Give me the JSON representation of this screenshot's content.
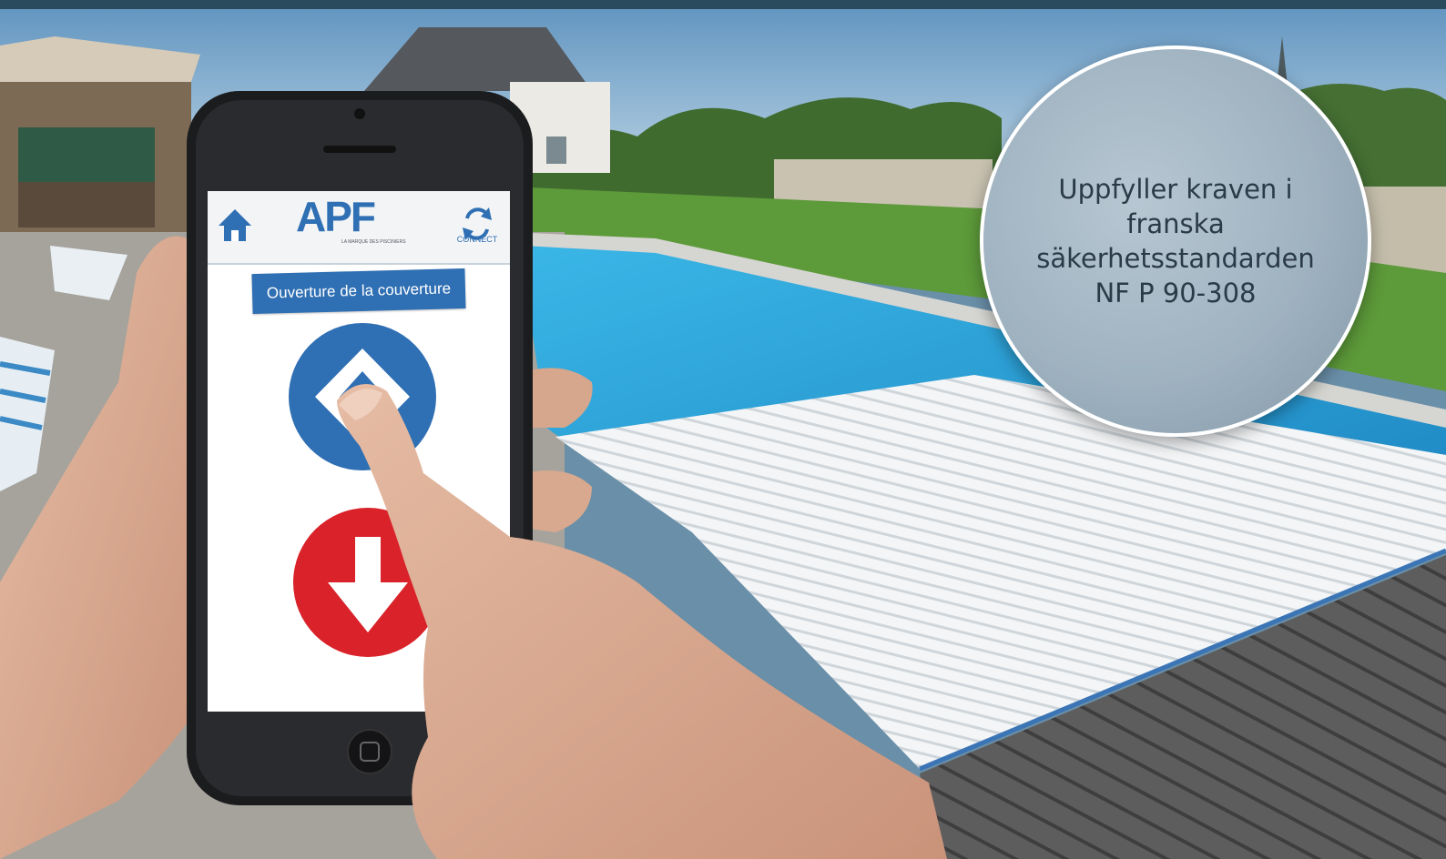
{
  "phone_app": {
    "logo_text": "APF",
    "logo_tagline": "LA MARQUE DES PISCINIERS",
    "connect_label": "CONNECT",
    "banner_label": "Ouverture de la couverture",
    "home_icon": "home-icon",
    "sync_icon": "sync-icon",
    "up_icon": "diamond-up-icon",
    "down_icon": "arrow-down-icon"
  },
  "badge": {
    "lines": [
      "Uppfyller kraven i",
      "franska",
      "säkerhetsstandarden",
      "NF P 90-308"
    ]
  },
  "colors": {
    "topbar": "#2a4a5e",
    "apf_blue": "#2f6fb3",
    "down_red": "#d9222a",
    "pool_water": "#2fa3d8",
    "badge_fill": "#9fb2c0"
  }
}
